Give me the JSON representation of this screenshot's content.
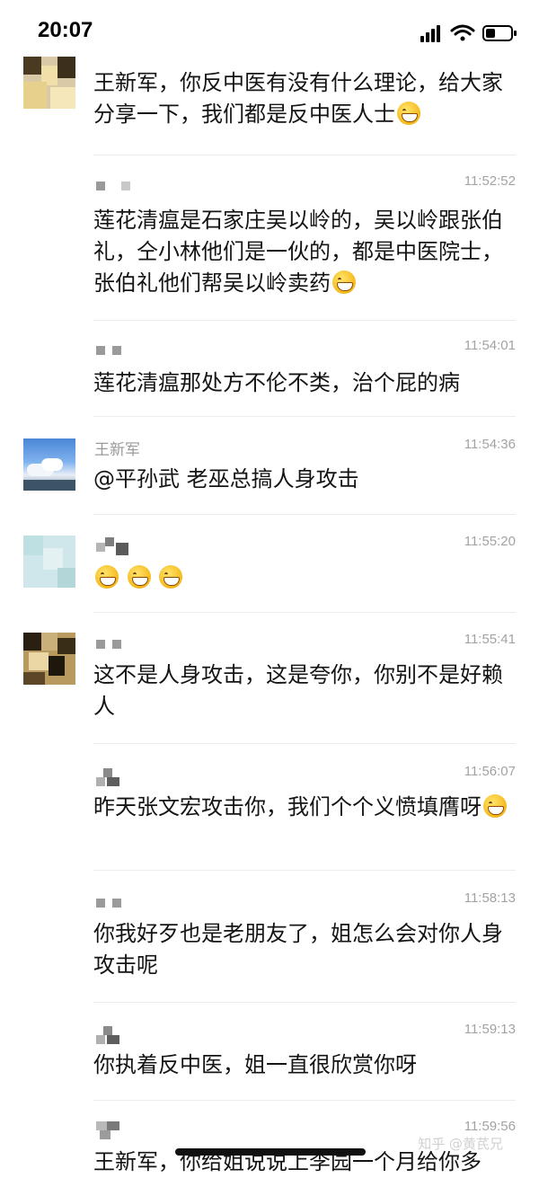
{
  "status_bar": {
    "time": "20:07"
  },
  "messages": [
    {
      "sender": "",
      "time": "",
      "text": "王新军，你反中医有没有什么理论，给大家分享一下，我们都是反中医人士",
      "emoji_count": 1
    },
    {
      "sender": "",
      "time": "11:52:52",
      "text": "莲花清瘟是石家庄吴以岭的，吴以岭跟张伯礼，仝小林他们是一伙的，都是中医院士，张伯礼他们帮吴以岭卖药",
      "emoji_count": 1
    },
    {
      "sender": "",
      "time": "11:54:01",
      "text": "莲花清瘟那处方不伦不类，治个屁的病",
      "emoji_count": 0
    },
    {
      "sender": "王新军",
      "time": "11:54:36",
      "text": "@平孙武 老巫总搞人身攻击",
      "emoji_count": 0
    },
    {
      "sender": "",
      "time": "11:55:20",
      "text": "",
      "emoji_count": 3
    },
    {
      "sender": "",
      "time": "11:55:41",
      "text": "这不是人身攻击，这是夸你，你别不是好赖人",
      "emoji_count": 0
    },
    {
      "sender": "",
      "time": "11:56:07",
      "text": "昨天张文宏攻击你，我们个个义愤填膺呀",
      "emoji_count": 1
    },
    {
      "sender": "",
      "time": "11:58:13",
      "text": "你我好歹也是老朋友了，姐怎么会对你人身攻击呢",
      "emoji_count": 0
    },
    {
      "sender": "",
      "time": "11:59:13",
      "text": "你执着反中医，姐一直很欣赏你呀",
      "emoji_count": 0
    },
    {
      "sender": "",
      "time": "11:59:56",
      "text": "王新军，你给姐说说上李园一个月给你多",
      "emoji_count": 0
    }
  ],
  "watermark": "知乎 @黄芪兄"
}
